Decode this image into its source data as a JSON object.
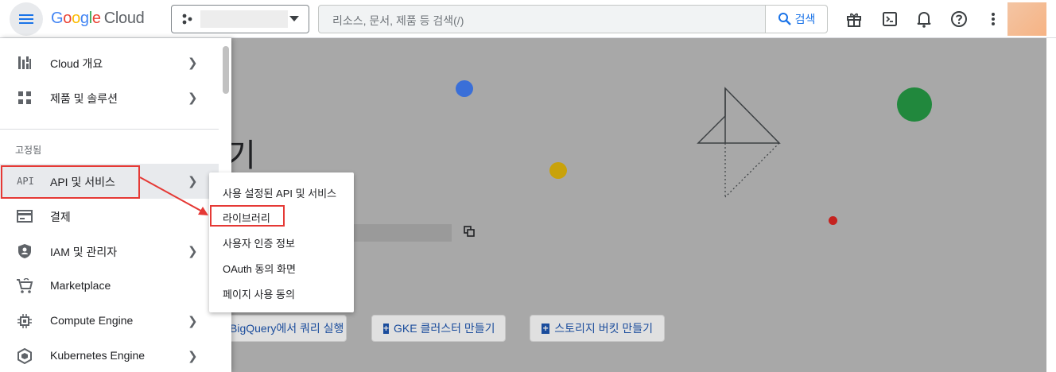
{
  "header": {
    "logo": {
      "google": [
        "G",
        "o",
        "o",
        "g",
        "l",
        "e"
      ],
      "cloud": "Cloud"
    },
    "search_placeholder": "리소스, 문서, 제품 등 검색(/)",
    "search_button": "검색",
    "icons": [
      "gift-icon",
      "cloud-shell-icon",
      "notifications-icon",
      "help-icon",
      "more-vert-icon"
    ]
  },
  "sidebar": {
    "items_top": [
      {
        "label": "Cloud 개요",
        "icon": "dashboard-icon",
        "chevron": true
      },
      {
        "label": "제품 및 솔루션",
        "icon": "grid-icon",
        "chevron": true
      }
    ],
    "section_title": "고정됨",
    "items_pinned": [
      {
        "label": "API 및 서비스",
        "icon": "api-icon",
        "icon_text": "API",
        "chevron": true,
        "active": true
      },
      {
        "label": "결제",
        "icon": "billing-icon",
        "chevron": false
      },
      {
        "label": "IAM 및 관리자",
        "icon": "shield-icon",
        "chevron": true
      },
      {
        "label": "Marketplace",
        "icon": "marketplace-icon",
        "chevron": false
      },
      {
        "label": "Compute Engine",
        "icon": "chip-icon",
        "chevron": true
      },
      {
        "label": "Kubernetes Engine",
        "icon": "kubernetes-icon",
        "chevron": true
      }
    ]
  },
  "submenu": {
    "items": [
      "사용 설정된 API 및 서비스",
      "라이브러리",
      "사용자 인증 정보",
      "OAuth 동의 화면",
      "페이지 사용 동의"
    ],
    "highlighted": "라이브러리"
  },
  "main": {
    "title_fragment": "기",
    "quick_actions": [
      "BigQuery에서 쿼리 실행",
      "GKE 클러스터 만들기",
      "스토리지 버킷 만들기"
    ]
  },
  "colors": {
    "highlight": "#e53935",
    "accent": "#1a73e8",
    "overlay": "#a8a8a8"
  }
}
